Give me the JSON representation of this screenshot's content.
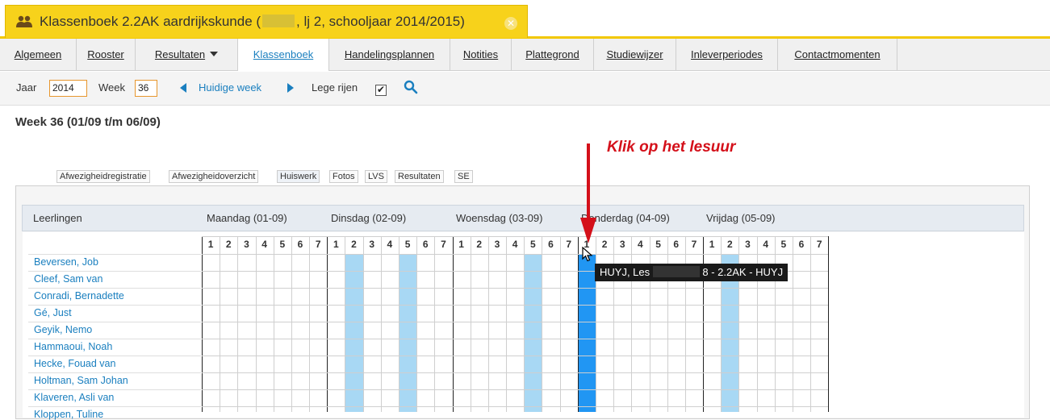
{
  "colors": {
    "accent": "#1a7fbf",
    "title_tab_bg": "#f7d21b",
    "highlight_light_blue": "#a8d8f4",
    "highlight_selected_blue": "#2196f3",
    "annotation_red": "#d4101a"
  },
  "title_tab": {
    "icon": "group-icon",
    "text_before": "Klassenboek 2.2AK aardrijkskunde (",
    "text_after": ", lj 2, schooljaar 2014/2015)",
    "close_icon": "close-circle-icon"
  },
  "nav": {
    "tabs": [
      {
        "label": "Algemeen"
      },
      {
        "label": "Rooster"
      },
      {
        "label": "Resultaten"
      },
      {
        "label": "Klassenboek",
        "active": true
      },
      {
        "label": "Handelingsplannen"
      },
      {
        "label": "Notities"
      },
      {
        "label": "Plattegrond"
      },
      {
        "label": "Studiewijzer"
      },
      {
        "label": "Inleverperiodes"
      },
      {
        "label": "Contactmomenten"
      }
    ]
  },
  "toolbar": {
    "jaar_label": "Jaar",
    "jaar_value": "2014",
    "week_label": "Week",
    "week_value": "36",
    "huidige_week_label": "Huidige week",
    "lege_rijen_label": "Lege rijen",
    "lege_rijen_checked": true,
    "search_icon": "search-icon"
  },
  "week_heading": "Week 36 (01/09 t/m 06/09)",
  "annotation": "Klik op het lesuur",
  "subtabs": [
    "Afwezigheidregistratie",
    "Afwezigheidoverzicht",
    "Huiswerk",
    "Fotos",
    "LVS",
    "Resultaten",
    "SE"
  ],
  "panel_header": {
    "students_label": "Leerlingen",
    "days": [
      "Maandag (01-09)",
      "Dinsdag (02-09)",
      "Woensdag (03-09)",
      "Donderdag (04-09)",
      "Vrijdag (05-09)"
    ]
  },
  "periods": [
    "1",
    "2",
    "3",
    "4",
    "5",
    "6",
    "7"
  ],
  "highlighted_slots": [
    {
      "day": 1,
      "period": 2,
      "state": "light"
    },
    {
      "day": 1,
      "period": 5,
      "state": "light"
    },
    {
      "day": 2,
      "period": 5,
      "state": "light"
    },
    {
      "day": 3,
      "period": 1,
      "state": "selected"
    },
    {
      "day": 4,
      "period": 2,
      "state": "light"
    }
  ],
  "students": [
    "Beversen, Job",
    "Cleef, Sam van",
    "Conradi, Bernadette",
    "Gé, Just",
    "Geyik, Nemo",
    "Hammaoui, Noah",
    "Hecke, Fouad van",
    "Holtman, Sam Johan",
    "Klaveren, Asli van",
    "Kloppen, Tuline"
  ],
  "tooltip": {
    "text_before": "HUYJ, Les",
    "text_after": "8 - 2.2AK - HUYJ"
  }
}
